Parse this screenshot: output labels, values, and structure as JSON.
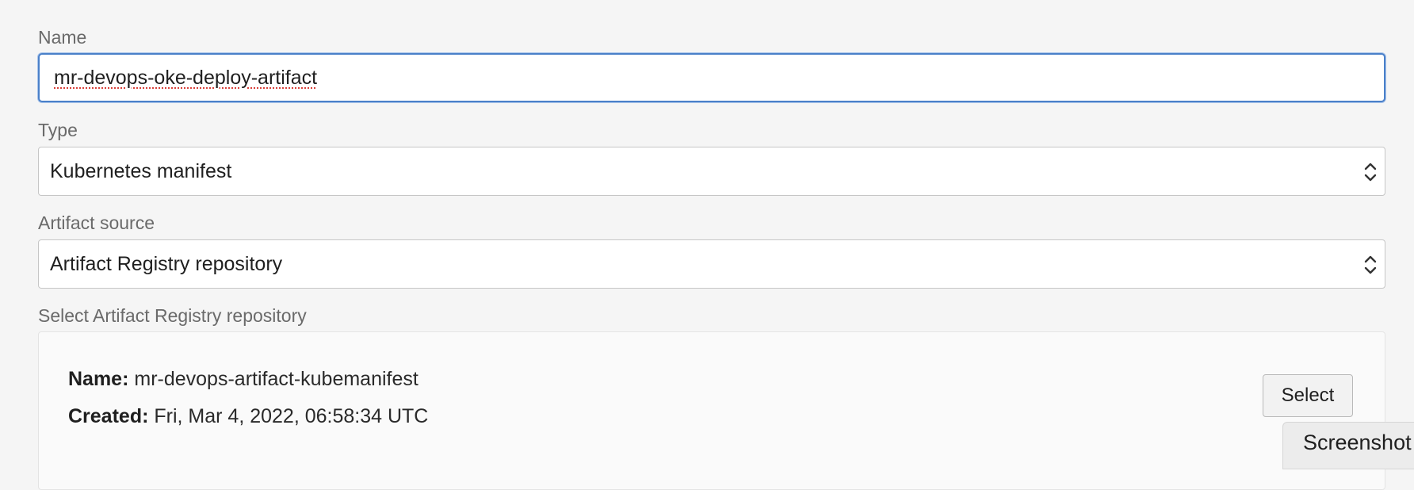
{
  "form": {
    "name": {
      "label": "Name",
      "value": "mr-devops-oke-deploy-artifact"
    },
    "type": {
      "label": "Type",
      "selected": "Kubernetes manifest"
    },
    "artifact_source": {
      "label": "Artifact source",
      "selected": "Artifact Registry repository"
    },
    "repository": {
      "label": "Select Artifact Registry repository",
      "name_label": "Name:",
      "name_value": "mr-devops-artifact-kubemanifest",
      "created_label": "Created:",
      "created_value": "Fri, Mar 4, 2022, 06:58:34 UTC",
      "select_button": "Select"
    }
  },
  "overlay": {
    "screenshot_label": "Screenshot"
  },
  "colors": {
    "focus_border": "#4a80c9",
    "background": "#f5f5f5",
    "spellcheck_underline": "#d9403a"
  },
  "icons": {
    "select_arrows": "chevron-up-down-icon"
  }
}
